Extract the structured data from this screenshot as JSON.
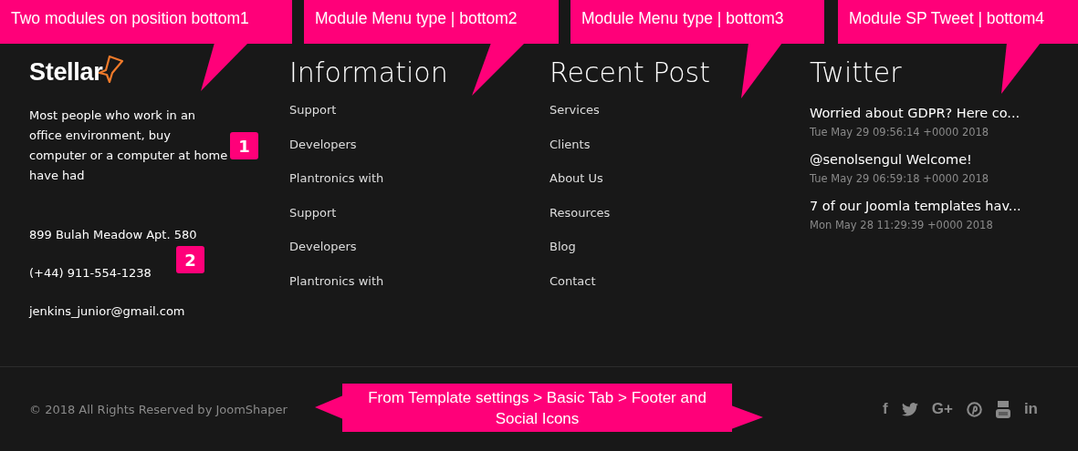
{
  "callouts": [
    {
      "text": "Two modules on position bottom1"
    },
    {
      "text": "Module Menu type | bottom2"
    },
    {
      "text": "Module Menu type | bottom3"
    },
    {
      "text": "Module SP Tweet | bottom4"
    }
  ],
  "about": {
    "logo": "Stellar",
    "description": "Most people who work in an office environment, buy computer or a computer at home have had",
    "address": "899 Bulah Meadow Apt. 580",
    "phone": "(+44) 911-554-1238",
    "email": "jenkins_junior@gmail.com"
  },
  "badges": [
    "1",
    "2"
  ],
  "menus": [
    {
      "title": "Information",
      "items": [
        "Support",
        "Developers",
        "Plantronics with",
        "Support",
        "Developers",
        "Plantronics with"
      ]
    },
    {
      "title": "Recent Post",
      "items": [
        "Services",
        "Clients",
        "About Us",
        "Resources",
        "Blog",
        "Contact"
      ]
    }
  ],
  "twitter": {
    "title": "Twitter",
    "tweets": [
      {
        "text": "Worried about GDPR? Here co...",
        "date": "Tue May 29 09:56:14 +0000 2018"
      },
      {
        "text": "@senolsengul Welcome!",
        "date": "Tue May 29 06:59:18 +0000 2018"
      },
      {
        "text": "7 of our Joomla templates hav...",
        "date": "Mon May 28 11:29:39 +0000 2018"
      }
    ]
  },
  "footer": {
    "copyright": "© 2018 All Rights Reserved by JoomShaper",
    "social": [
      {
        "kind": "facebook",
        "label": "f"
      },
      {
        "kind": "twitter"
      },
      {
        "kind": "google-plus",
        "label": "G+"
      },
      {
        "kind": "pinterest"
      },
      {
        "kind": "youtube"
      },
      {
        "kind": "linkedin",
        "label": "in"
      }
    ]
  },
  "footer_callout": {
    "text": "From Template settings > Basic Tab > Footer and Social Icons"
  }
}
